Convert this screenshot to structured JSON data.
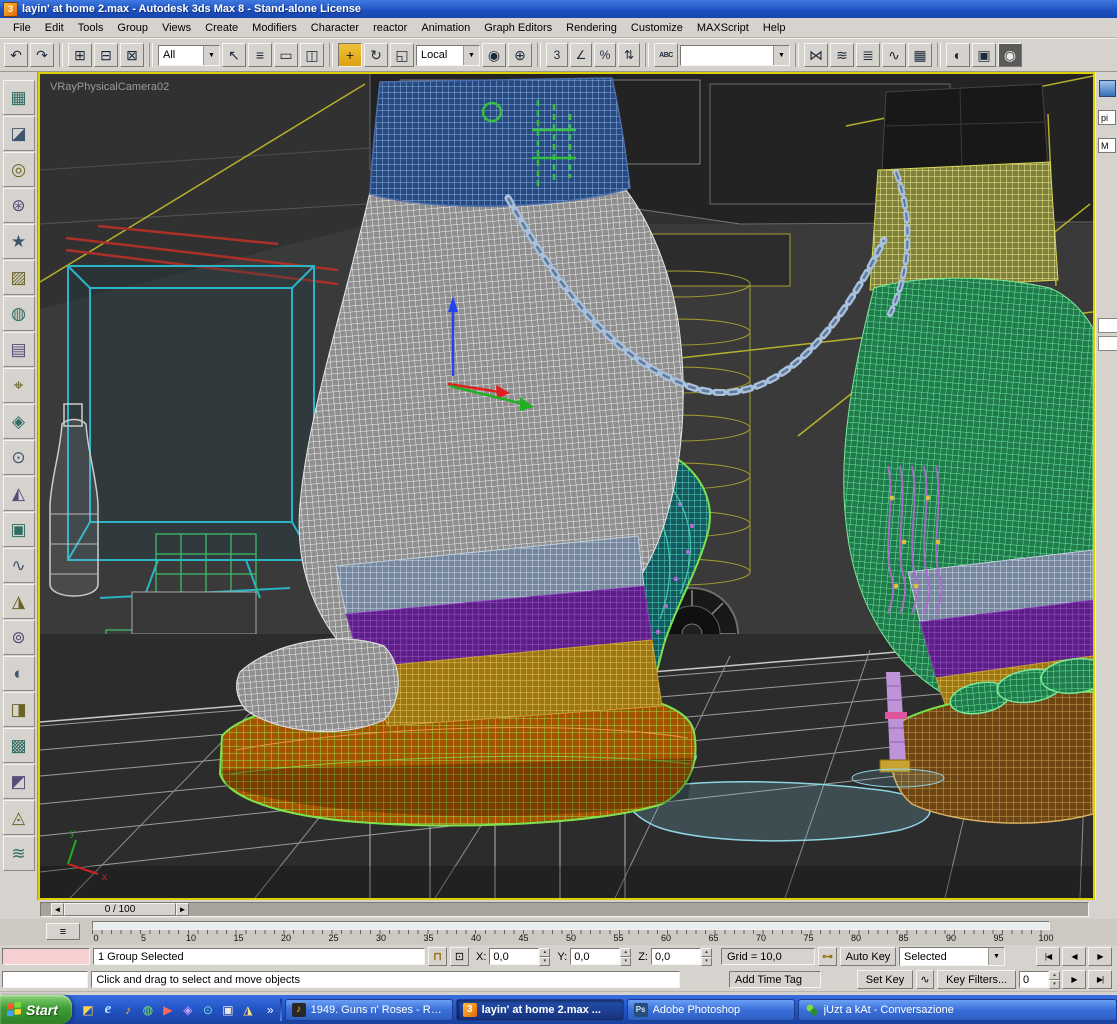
{
  "palette": {
    "titlebar_blue": "#1d4fc0",
    "chrome_gray": "#d6d3ce",
    "viewport_border_yellow": "#ddd000",
    "active_tool_highlight": "#dca010",
    "taskbar_blue": "#2456c8",
    "start_green": "#3f9e38",
    "maxscript_pink": "#f6cfd0"
  },
  "window": {
    "title": "layin' at home 2.max - Autodesk 3ds Max 8  - Stand-alone License"
  },
  "menu": {
    "items": [
      "File",
      "Edit",
      "Tools",
      "Group",
      "Views",
      "Create",
      "Modifiers",
      "Character",
      "reactor",
      "Animation",
      "Graph Editors",
      "Rendering",
      "Customize",
      "MAXScript",
      "Help"
    ]
  },
  "toolbar": {
    "selection_filter": "All",
    "coord_system": "Local",
    "named_selection": ""
  },
  "icons": {
    "app": "3",
    "undo": "↶",
    "redo": "↷",
    "select_link": "⊞",
    "unlink": "⊟",
    "bind_spacewarp": "⊠",
    "dropdown_arrow": "▼",
    "select_object": "↖",
    "select_by_name": "≡",
    "region_select": "▭",
    "window_crossing": "◫",
    "move": "+",
    "rotate": "↻",
    "scale": "◱",
    "use_pivot": "◉",
    "manipulate": "⊕",
    "snap_toggle": "3",
    "angle_snap": "∠",
    "percent_snap": "%",
    "spinner_snap": "⇅",
    "named_sel_edit": "ABC",
    "mirror": "⋈",
    "align": "≋",
    "layer_manager": "≣",
    "curve_editor": "∿",
    "schematic_view": "▦",
    "material_editor": "◐",
    "render_setup": "▣",
    "quick_render": "◉",
    "lock_selection": "⊓",
    "abs_offset": "⊡",
    "key_icon": "⊶",
    "spinner_up": "▴",
    "spinner_down": "▾",
    "go_to_start": "|◀",
    "previous_frame": "◀",
    "play": "▶",
    "next_frame": "▶",
    "go_to_end": "▶|",
    "slider_left": "◄",
    "slider_right": "►",
    "mini_track": "≡",
    "taskbar_overflow": "»",
    "task_winamp": "♪",
    "task_max": "3",
    "task_ps": "Ps",
    "quick_launch": [
      "◩",
      "e",
      "♪",
      "◍",
      "▶",
      "◈",
      "⊙",
      "▣",
      "◮"
    ],
    "left_toolbar": [
      "▦",
      "◪",
      "◎",
      "⊛",
      "★",
      "▨",
      "◍",
      "▤",
      "⌖",
      "◈",
      "⊙",
      "◭",
      "▣",
      "∿",
      "◮",
      "⊚",
      "◐",
      "◨",
      "▩",
      "◩",
      "◬",
      "≋"
    ]
  },
  "viewport": {
    "camera_label": "VRayPhysicalCamera02",
    "axis_x": "x",
    "axis_y": "y"
  },
  "timeline": {
    "slider_label": "0 / 100"
  },
  "trackbar": {
    "ticks": [
      "0",
      "5",
      "10",
      "15",
      "20",
      "25",
      "30",
      "35",
      "40",
      "45",
      "50",
      "55",
      "60",
      "65",
      "70",
      "75",
      "80",
      "85",
      "90",
      "95",
      "100"
    ]
  },
  "status": {
    "selection_text": "1 Group Selected",
    "prompt_text": "Click and drag to select and move objects",
    "x_label": "X:",
    "x_value": "0,0",
    "y_label": "Y:",
    "y_value": "0,0",
    "z_label": "Z:",
    "z_value": "0,0",
    "grid_label": "Grid = 10,0",
    "add_time_tag": "Add Time Tag",
    "auto_key_label": "Auto Key",
    "set_key_label": "Set Key",
    "selected_set": "Selected",
    "key_filters_label": "Key Filters...",
    "frame_value": "0"
  },
  "side_panel": {
    "field1": "pi",
    "field2": "M"
  },
  "taskbar": {
    "start_label": "Start",
    "tasks": [
      {
        "label": "1949. Guns n' Roses - Ra..."
      },
      {
        "label": "layin' at home 2.max ..."
      },
      {
        "label": "Adobe Photoshop"
      },
      {
        "label": "jUzt a kAt - Conversazione"
      }
    ]
  }
}
